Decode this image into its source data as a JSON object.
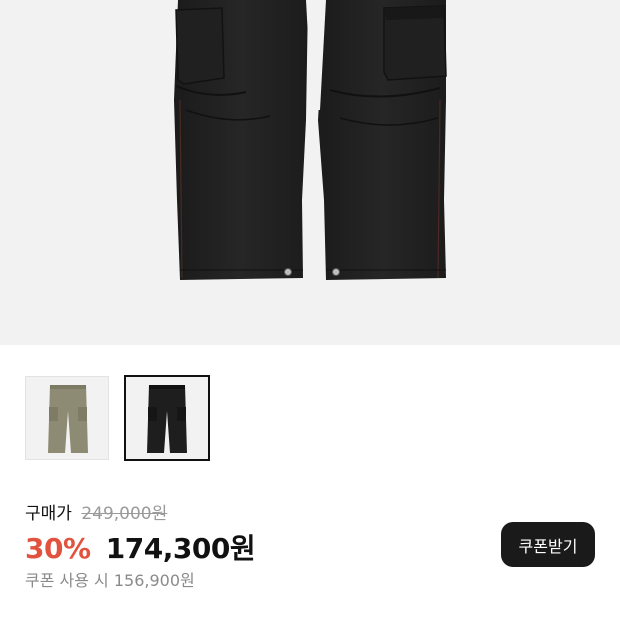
{
  "product": {
    "main_image_icon": "black-cargo-pants-image",
    "thumbnails": [
      {
        "icon": "khaki-cargo-pants-thumbnail",
        "color": "#8e8b74",
        "selected": false
      },
      {
        "icon": "black-cargo-pants-thumbnail",
        "color": "#1e1e1e",
        "selected": true
      }
    ]
  },
  "price": {
    "label": "구매가",
    "original": "249,000원",
    "discount_percent": "30%",
    "sale_price": "174,300원",
    "coupon_text": "쿠폰 사용 시 156,900원",
    "accent_color": "#e2533f"
  },
  "coupon_button": {
    "label": "쿠폰받기"
  }
}
